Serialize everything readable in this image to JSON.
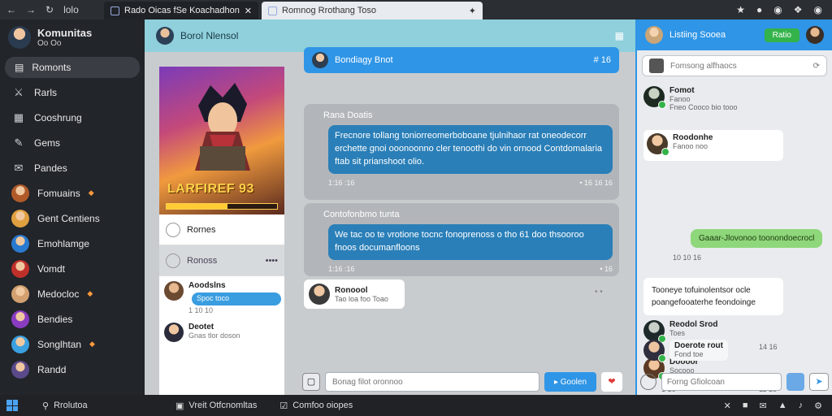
{
  "browser": {
    "tab_active": "Rado Oicas fSe Koachadhonotas",
    "tab_second": "Romnog Rrothang Toso",
    "nav_icons": [
      "back-icon",
      "forward-icon",
      "reload-icon"
    ],
    "nav_label": "lolo",
    "right_icons": [
      "bookmark-star-icon",
      "extension-icon",
      "profile-icon",
      "puzzle-icon",
      "menu-icon"
    ]
  },
  "sidebar": {
    "title": "Komunitas",
    "subtitle": "Oo Oo",
    "active_item": "Romonts",
    "items": [
      {
        "label": "Rarls",
        "icon": "people-icon"
      },
      {
        "label": "Cooshrung",
        "icon": "game-controller-icon"
      },
      {
        "label": "Gems",
        "icon": "pencil-icon"
      },
      {
        "label": "Pandes",
        "icon": "chat-icon"
      },
      {
        "label": "Fomuains",
        "icon": "avatar",
        "hot": true
      },
      {
        "label": "Gent Centiens",
        "icon": "avatar"
      },
      {
        "label": "Emohlamge",
        "icon": "avatar"
      },
      {
        "label": "Vomdt",
        "icon": "avatar"
      },
      {
        "label": "Medocloc",
        "icon": "avatar",
        "hot": true
      },
      {
        "label": "Bendies",
        "icon": "avatar"
      },
      {
        "label": "Songlhtan",
        "icon": "avatar",
        "hot": true
      },
      {
        "label": "Randd",
        "icon": "avatar"
      }
    ]
  },
  "channel": {
    "title": "Borol Nlensol"
  },
  "game": {
    "logo": "LARFIREF 93",
    "progress": 0.55,
    "row1": "Rornes",
    "row2": "Ronoss",
    "row2_meta": "••••",
    "msgs": [
      {
        "name": "Aoodslns",
        "bubble": "Spoc toco",
        "time": "1 10 10"
      },
      {
        "name": "Deotet",
        "text": "Gnas tlor doson",
        "time": "•"
      }
    ]
  },
  "chat": {
    "pinned_title": "Bondiagy Bnot",
    "pinned_count": "# 16",
    "card1": {
      "header": "Rana Doatis",
      "bubble": "Frecnore tollang toniorreomerboboane tjulnihaor rat oneodecorr erchette gnoi ooonoonno cler tenoothi do vin ornood Contdomalaria ftab sit prianshoot olio.",
      "meta_left": "1:16 :16",
      "meta_right": "• 16 16 16"
    },
    "card2": {
      "header": "Contofonbmo tunta",
      "bubble": "We tac oo te vrotione tocnc fonoprenoss o tho 61 doo thsooroo fnoos documanfloons",
      "meta_left": "1:16 :16",
      "meta_right": "• 16"
    },
    "reply_name": "Ronoool",
    "reply_text": "Tao loa foo Toao",
    "reply_dots": "• •",
    "compose_placeholder": "Bonag filot oronnoo",
    "send_label": "Goolen"
  },
  "right": {
    "header_title": "Listiing Sooea",
    "header_button": "Ratio",
    "search_placeholder": "Fomsong alfhaocs",
    "items": [
      {
        "name": "Fomot",
        "text": "Fanoo",
        "extra": "Fneo Cooco bio tooo"
      },
      {
        "name": "Roodonhe",
        "text": "Fanoo noo"
      },
      {
        "name": "Reodol Srod",
        "text": "Toes"
      },
      {
        "name": "Dooool",
        "text": "Socooo"
      },
      {
        "name": "Doerote rout",
        "text": "Fond toe"
      }
    ],
    "green_bubble": "Gaaar-Jlovonoo toonondoecrocl",
    "green_meta": "10 10 16",
    "white_bubble": "Tooneye tofuinolentsor ocle poangefooaterhe feondoinge",
    "time_a": "14 16",
    "time_b": "1 16",
    "time_c": "11 16",
    "compose_placeholder": "Forng Gfiolcoan"
  },
  "taskbar": {
    "search": "Rrolutoa",
    "app1": "Vreit Otfcnomltas",
    "app2": "Comfoo oiopes"
  }
}
